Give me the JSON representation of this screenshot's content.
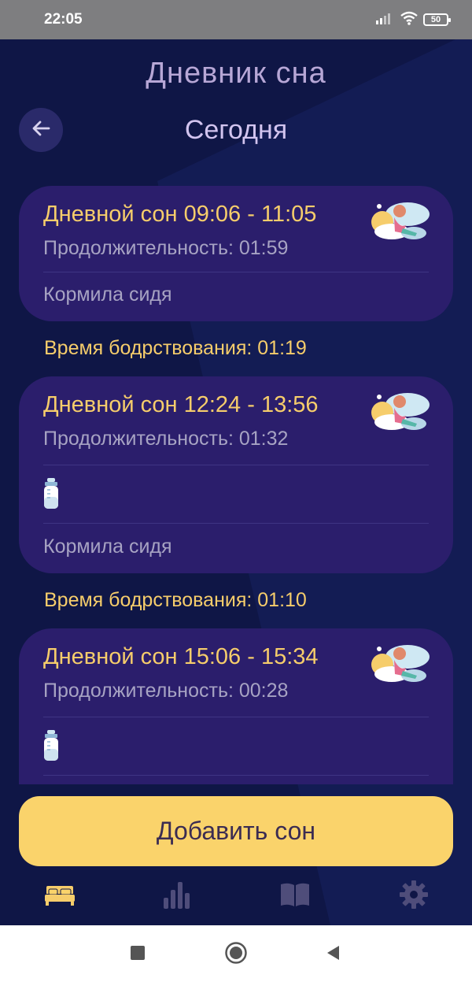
{
  "status_bar": {
    "time": "22:05",
    "battery": "50",
    "icons": [
      "signal-icon",
      "wifi-icon",
      "battery-icon"
    ]
  },
  "header": {
    "title": "Дневник сна",
    "subtitle": "Сегодня",
    "back_icon": "arrow-left-icon"
  },
  "entries": [
    {
      "title": "Дневной сон 09:06 - 11:05",
      "duration": "Продолжительность: 01:59",
      "note": "Кормила сидя",
      "has_bottle": false,
      "illustration": "sleeping-baby-cloud-illustration"
    },
    {
      "title": "Дневной сон 12:24 - 13:56",
      "duration": "Продолжительность: 01:32",
      "note": "Кормила сидя",
      "has_bottle": true,
      "illustration": "sleeping-baby-cloud-illustration"
    },
    {
      "title": "Дневной сон 15:06 - 15:34",
      "duration": "Продолжительность: 00:28",
      "note": "",
      "has_bottle": true,
      "illustration": "sleeping-baby-cloud-illustration"
    }
  ],
  "wake_windows": [
    "Время бодрствования: 01:19",
    "Время бодрствования: 01:10"
  ],
  "add_button": {
    "label": "Добавить сон"
  },
  "bottom_nav": [
    {
      "name": "sleep",
      "icon": "bed-icon",
      "active": true
    },
    {
      "name": "statistics",
      "icon": "bar-chart-icon",
      "active": false
    },
    {
      "name": "articles",
      "icon": "book-icon",
      "active": false
    },
    {
      "name": "settings",
      "icon": "gear-icon",
      "active": false
    }
  ],
  "system_nav": [
    "recents-square-icon",
    "home-circle-icon",
    "back-triangle-icon"
  ],
  "colors": {
    "background": "#0f1646",
    "card": "#2b1e6c",
    "accent_yellow": "#f6cd6b",
    "button_yellow": "#fad36b",
    "title_lavender": "#b7a7d6",
    "muted_text": "#a7a3c3",
    "nav_inactive": "#4f4d7a"
  }
}
